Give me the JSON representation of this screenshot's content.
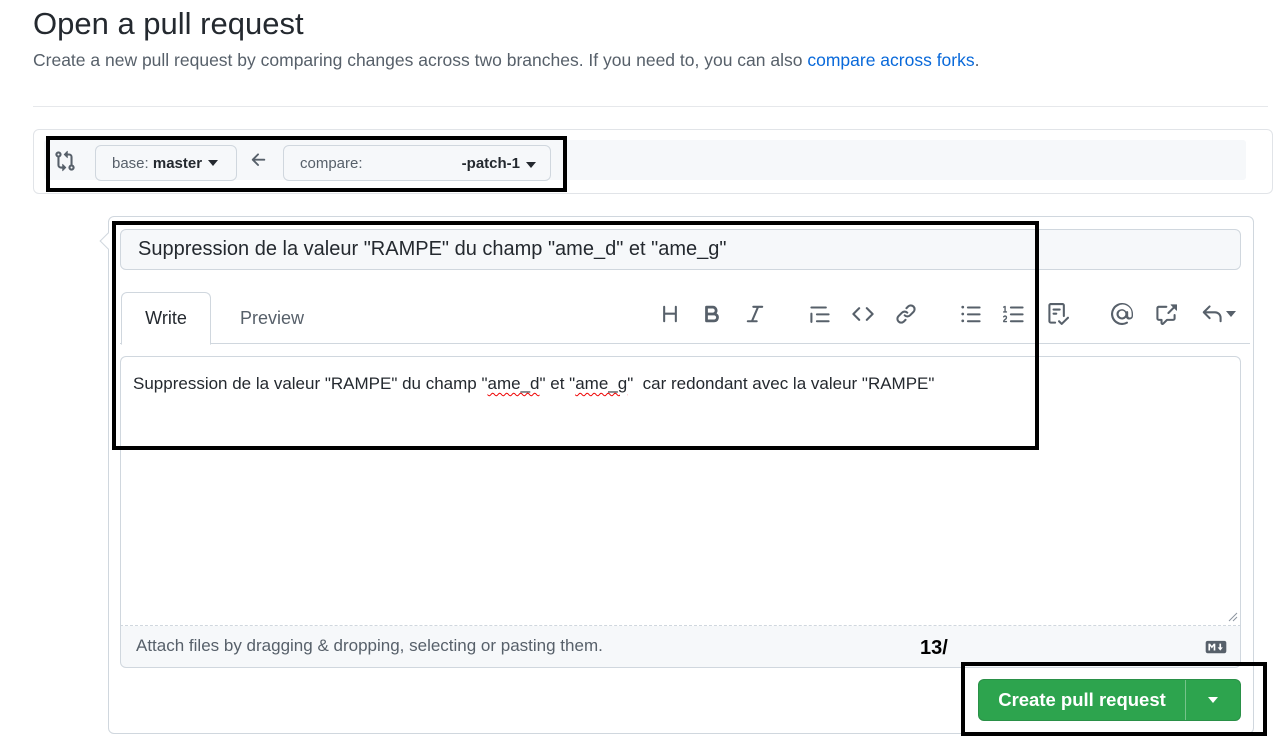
{
  "header": {
    "title": "Open a pull request",
    "subtitle_prefix": "Create a new pull request by comparing changes across two branches. If you need to, you can also ",
    "subtitle_link": "compare across forks",
    "subtitle_suffix": "."
  },
  "range": {
    "base_prefix": "base: ",
    "base_branch": "master",
    "compare_prefix": "compare:",
    "compare_branch": "-patch-1"
  },
  "form": {
    "title_value": "Suppression de la valeur \"RAMPE\" du champ \"ame_d\" et \"ame_g\"",
    "tabs": [
      "Write",
      "Preview"
    ],
    "toolbar_icons": [
      "heading-icon",
      "bold-icon",
      "italic-icon",
      "quote-icon",
      "code-icon",
      "link-icon",
      "bulleted-list-icon",
      "numbered-list-icon",
      "task-list-icon",
      "mention-icon",
      "cross-reference-icon",
      "saved-replies-icon"
    ],
    "body": {
      "part1": "Suppression de la valeur \"RAMPE\" du champ \"",
      "word1": "ame_d",
      "part2": "\" et \"",
      "word2": "ame_g",
      "part3": "\"  car redondant avec la valeur \"RAMPE\""
    },
    "attach_text": "Attach files by dragging & dropping, selecting or pasting them."
  },
  "annotation": "13/",
  "create_button": {
    "label": "Create pull request"
  },
  "colors": {
    "primary_green": "#2da44e",
    "link_blue": "#0969da",
    "highlight_border": "#000000"
  }
}
